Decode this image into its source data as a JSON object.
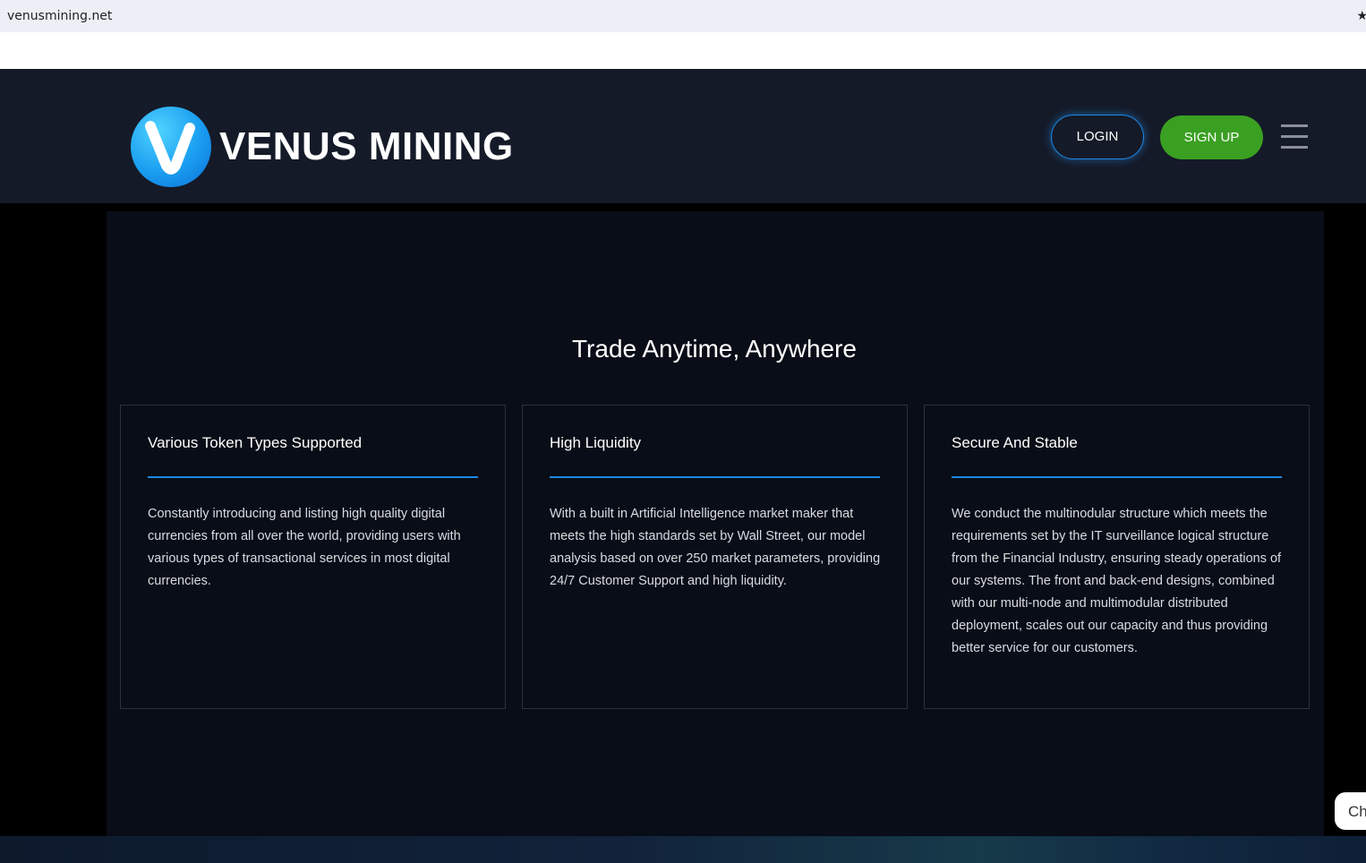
{
  "browser": {
    "url": "venusmining.net"
  },
  "header": {
    "logo_text": "VENUS MINING",
    "login_label": "LOGIN",
    "signup_label": "SIGN UP"
  },
  "main": {
    "title": "Trade Anytime, Anywhere",
    "cards": [
      {
        "title": "Various Token Types Supported",
        "body": "Constantly introducing and listing high quality digital currencies from all over the world, providing users with various types of transactional services in most digital currencies."
      },
      {
        "title": "High Liquidity",
        "body": "With a built in Artificial Intelligence market maker that meets the high standards set by Wall Street, our model analysis based on over 250 market parameters, providing 24/7 Customer Support and high liquidity."
      },
      {
        "title": "Secure And Stable",
        "body": "We conduct the multinodular structure which meets the requirements set by the IT surveillance logical structure from the Financial Industry, ensuring steady operations of our systems. The front and back-end designs, combined with our multi-node and multimodular distributed deployment, scales out our capacity and thus providing better service for our customers."
      }
    ]
  },
  "chat": {
    "label": "Ch"
  },
  "colors": {
    "header_bg": "#151a28",
    "panel_bg": "#090d17",
    "accent_blue": "#1e88e5",
    "signup_green": "#3aa022"
  },
  "icons": {
    "logo": "venus-v-logo-icon",
    "menu": "hamburger-menu-icon",
    "bookmark": "star-icon"
  }
}
